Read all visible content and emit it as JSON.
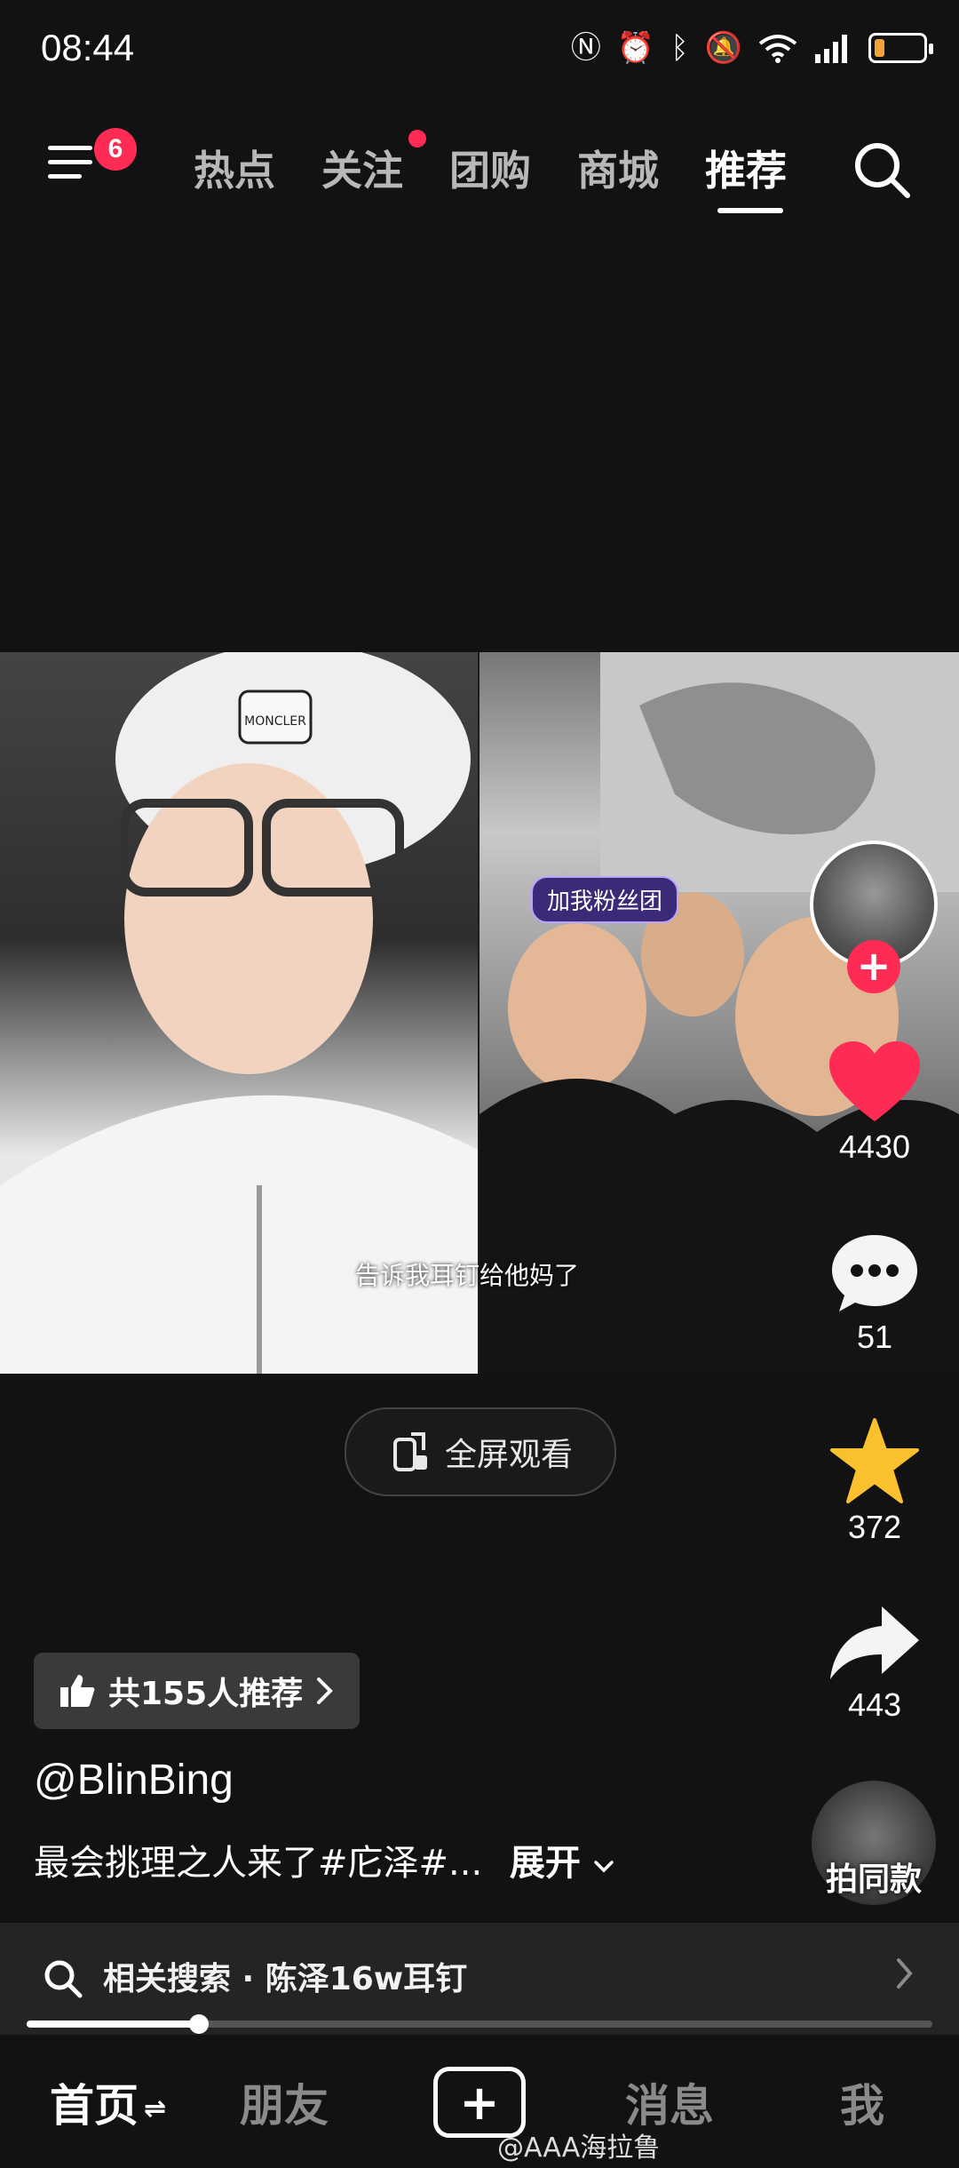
{
  "status_bar": {
    "time": "08:44",
    "icons": [
      "nfc-icon",
      "alarm-icon",
      "bluetooth-icon",
      "mute-icon",
      "wifi-icon",
      "signal-icon",
      "battery-low-icon"
    ],
    "battery_level": 0.2,
    "battery_color": "#f3a23a"
  },
  "top_nav": {
    "menu_badge": "6",
    "tabs": [
      "热点",
      "关注",
      "团购",
      "商城",
      "推荐"
    ],
    "active_tab": "推荐",
    "follow_tab_dot_color": "#fe2c55"
  },
  "video": {
    "subtitle": "告诉我耳钉给他妈了",
    "fans_tag": "加我粉丝团",
    "brand_patch": "MONCLER"
  },
  "right_rail": {
    "like_count": "4430",
    "comment_count": "51",
    "favorite_count": "372",
    "share_count": "443",
    "same_style_label": "拍同款",
    "accent": "#fe2c55",
    "star_color": "#fbc02d"
  },
  "fullscreen": {
    "label": "全屏观看"
  },
  "post": {
    "recommend_label": "共155人推荐",
    "author": "@BlinBing",
    "caption": "最会挑理之人来了#庀泽#...",
    "expand_label": "展开"
  },
  "related_search": {
    "text": "相关搜索 · 陈泽16w耳钉"
  },
  "playback": {
    "progress": 0.19
  },
  "bottom_nav": {
    "home": "首页",
    "friends": "朋友",
    "messages": "消息",
    "me": "我"
  },
  "watermark": "@AAA海拉鲁"
}
